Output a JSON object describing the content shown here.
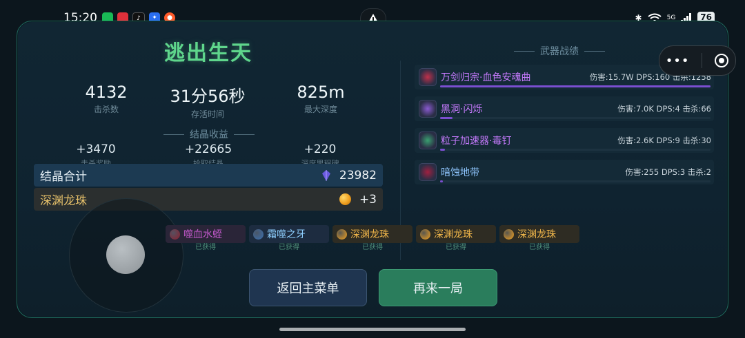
{
  "status": {
    "time": "15:20",
    "network": "5G",
    "battery": "76"
  },
  "game": {
    "title": "逃出生天",
    "stats": [
      {
        "value": "4132",
        "label": "击杀数"
      },
      {
        "value": "31分56秒",
        "label": "存活时间"
      },
      {
        "value": "825m",
        "label": "最大深度"
      }
    ],
    "crystal_section_title": "结晶收益",
    "crystal_breakdown": [
      {
        "value": "+3470",
        "label": "击杀奖励"
      },
      {
        "value": "+22665",
        "label": "拾取结晶"
      },
      {
        "value": "+220",
        "label": "深度里程碑"
      }
    ],
    "crystal_total": {
      "label": "结晶合计",
      "value": "23982"
    },
    "abyss_orb": {
      "label": "深渊龙珠",
      "value": "+3"
    },
    "rewards": [
      {
        "name": "噬血水蛭",
        "status": "已获得",
        "color": "#c75ad0",
        "bg": "#2a2538",
        "icon_color": "#8a2030"
      },
      {
        "name": "霜噬之牙",
        "status": "已获得",
        "color": "#8fd0ff",
        "bg": "#1d2c40",
        "icon_color": "#3a6fb0"
      },
      {
        "name": "深渊龙珠",
        "status": "已获得",
        "color": "#f0b64a",
        "bg": "#2e2c23",
        "icon_color": "#f0a020"
      },
      {
        "name": "深渊龙珠",
        "status": "已获得",
        "color": "#f0b64a",
        "bg": "#2e2c23",
        "icon_color": "#f0a020"
      },
      {
        "name": "深渊龙珠",
        "status": "已获得",
        "color": "#f0b64a",
        "bg": "#2e2c23",
        "icon_color": "#f0a020"
      }
    ],
    "buttons": {
      "menu": "返回主菜单",
      "again": "再来一局"
    },
    "weapons_title": "武器战绩",
    "weapons": [
      {
        "name": "万剑归宗·血色安魂曲",
        "stats": "伤害:15.7W DPS:160 击杀:1258",
        "name_color": "#c77bff",
        "progress": 1.0
      },
      {
        "name": "黑洞·闪烁",
        "stats": "伤害:7.0K DPS:4 击杀:66",
        "name_color": "#c77bff",
        "progress": 0.045
      },
      {
        "name": "粒子加速器·毒钉",
        "stats": "伤害:2.6K DPS:9 击杀:30",
        "name_color": "#c77bff",
        "progress": 0.017
      },
      {
        "name": "暗蚀地带",
        "stats": "伤害:255 DPS:3 击杀:2",
        "name_color": "#8fc6ff",
        "progress": 0.002
      }
    ]
  }
}
